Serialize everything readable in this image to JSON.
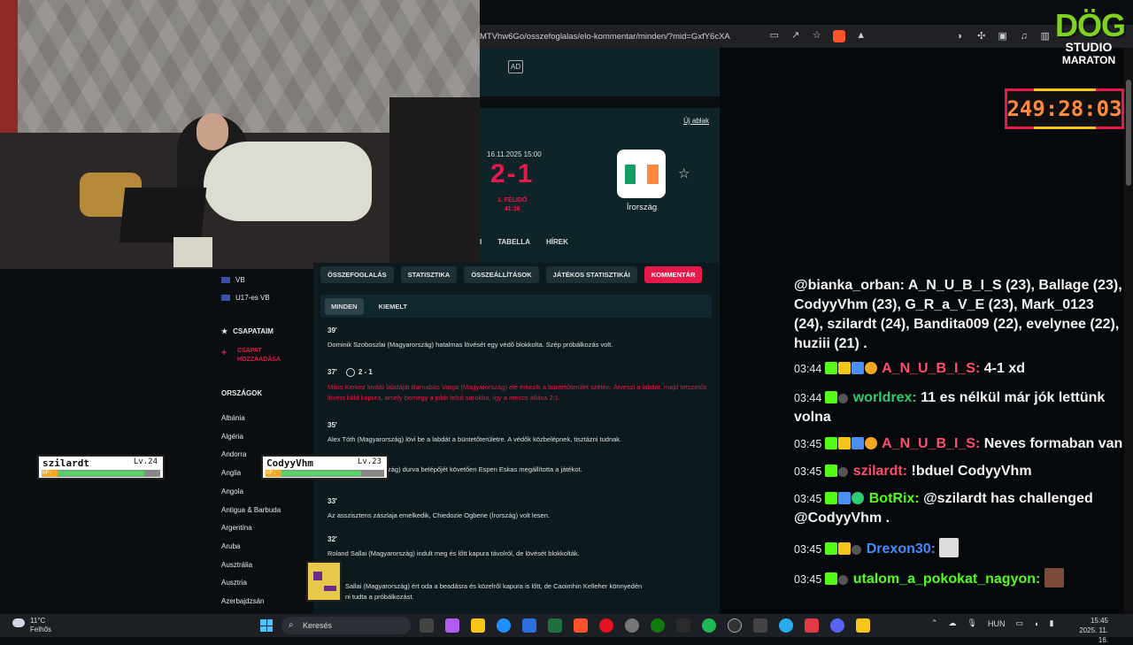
{
  "browser": {
    "url": "MTVhw6Go/osszefoglalas/elo-kommentar/minden/?mid=GxfY6cXA"
  },
  "stream": {
    "logo_line1": "DÖG",
    "logo_line2": "STUDIO",
    "logo_line3": "MARATON",
    "timer": "249:28:03"
  },
  "ad": {
    "label": "AD"
  },
  "match": {
    "new_window": "Új ablak",
    "date": "16.11.2025 15:00",
    "score": "2-1",
    "period_line1": "1. FÉLIDŐ",
    "period_line2": "41:36",
    "team": "Írország",
    "flag_colors": [
      "#169b62",
      "#ffffff",
      "#ff883e"
    ],
    "tabs": [
      "I",
      "TABELLA",
      "HÍREK"
    ]
  },
  "sidebar": {
    "items": [
      {
        "label": "VB"
      },
      {
        "label": "U17-es VB"
      }
    ],
    "my_teams": "CSAPATAIM",
    "add_team_line1": "CSAPAT",
    "add_team_line2": "HOZZÁADÁSA",
    "countries_heading": "ORSZÁGOK",
    "countries": [
      "Albánia",
      "Algéria",
      "Andorra",
      "Anglia",
      "Angola",
      "Antigua & Barbuda",
      "Argentína",
      "Aruba",
      "Ausztrália",
      "Ausztria",
      "Azerbajdzsán"
    ]
  },
  "commentary": {
    "tabs": [
      "ÖSSZEFOGLALÁS",
      "STATISZTIKA",
      "ÖSSZEÁLLÍTÁSOK",
      "JÁTÉKOS STATISZTIKÁI",
      "KOMMENTÁR"
    ],
    "subtabs": [
      "MINDEN",
      "KIEMELT"
    ],
    "entries": [
      {
        "minute": "39'",
        "text": "Dominik Szoboszlai (Magyarország) hatalmas lövését egy védő blokkolta. Szép próbálkozás volt."
      },
      {
        "minute": "37'",
        "goal": "2 - 1",
        "text": "Milos Kerkez kiváló labdáját Barnabás Varga (Magyarország) elé érkezik a büntetőterület szélén. Átveszi a labdát, majd tetszetős lövést küld kapura, amely bemegy a jobb felső sarokba, így a meccs állása 2:1."
      },
      {
        "minute": "35'",
        "text": "Alex Tóth (Magyarország) lövi be a labdát a büntetőterületre. A védők közbelépnek, tisztázni tudnak."
      },
      {
        "minute": "",
        "text": "zág) durva belépőjét követően Espen Eskas megállította a játékot."
      },
      {
        "minute": "33'",
        "text": "Az asszisztens zászlaja emelkedik, Chiedozie Ogbene (Írország) volt lesen."
      },
      {
        "minute": "32'",
        "text": "Roland Sallai (Magyarország) indult meg és lőtt kapura távolról, de lövését blokkolták."
      },
      {
        "minute": "",
        "text": "Sallai (Magyarország) ért oda a beadásra és közelről kapura is lőtt, de Caoimhin Kelleher könnyedén"
      },
      {
        "minute": "",
        "text": "ni tudta a próbálkozást."
      }
    ]
  },
  "overlays": {
    "hp1": {
      "name": "szilardt",
      "level": "Lv.24",
      "hp_label": "HP:",
      "hp_fraction": 0.85
    },
    "hp2": {
      "name": "CodyyVhm",
      "level": "Lv.23",
      "hp_label": "HP:",
      "hp_fraction": 0.78
    }
  },
  "chat": {
    "header_text": "@bianka_orban: A_N_U_B_I_S (23), Ballage (23), CodyyVhm (23), G_R_a_V_E (23), Mark_0123 (24), szilardt (24), Bandita009 (22), evelynee (22), huziii (21) .",
    "messages": [
      {
        "time": "03:44",
        "user": "A_N_U_B_I_S:",
        "user_color": "#ff4d6d",
        "text": "4-1 xd"
      },
      {
        "time": "03:44",
        "user": "worldrex:",
        "user_color": "#2ecc71",
        "text": "11 es nélkül már jók lettünk volna"
      },
      {
        "time": "03:45",
        "user": "A_N_U_B_I_S:",
        "user_color": "#ff4d6d",
        "text": "Neves formaban van"
      },
      {
        "time": "03:45",
        "user": "szilardt:",
        "user_color": "#ff4d6d",
        "text": "!bduel CodyyVhm"
      },
      {
        "time": "03:45",
        "user": "BotRix:",
        "user_color": "#53fc18",
        "text": "@szilardt has challenged @CodyyVhm ."
      },
      {
        "time": "03:45",
        "user": "Drexon30:",
        "user_color": "#3f8cff",
        "text": ""
      },
      {
        "time": "03:45",
        "user": "utalom_a_pokokat_nagyon:",
        "user_color": "#53fc18",
        "text": ""
      }
    ]
  },
  "taskbar": {
    "temp": "11°C",
    "weather": "Felhős",
    "search_placeholder": "Keresés",
    "language": "HUN",
    "time": "15:45",
    "date": "2025. 11. 16."
  }
}
